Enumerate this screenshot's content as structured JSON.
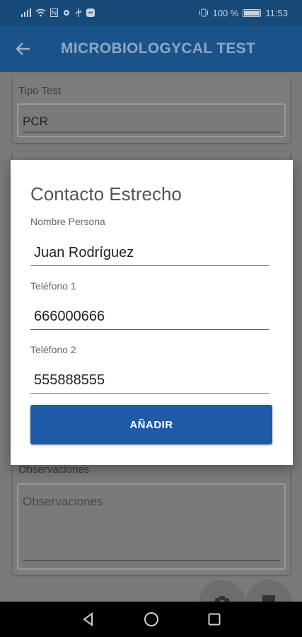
{
  "status_bar": {
    "battery_text": "100 %",
    "time": "11:53"
  },
  "app_bar": {
    "title": "MICROBIOLOGYCAL TEST"
  },
  "background": {
    "tipo_test_label": "Tipo Test",
    "tipo_test_value": "PCR",
    "observaciones_label": "Observaciones",
    "observaciones_placeholder": "Observaciones"
  },
  "dialog": {
    "title": "Contacto Estrecho",
    "nombre_label": "Nombre Persona",
    "nombre_value": "Juan Rodríguez",
    "telefono1_label": "Teléfono 1",
    "telefono1_value": "666000666",
    "telefono2_label": "Teléfono 2",
    "telefono2_value": "555888555",
    "add_button": "AÑADIR"
  },
  "colors": {
    "app_bar": "#1a538a",
    "button": "#1f5aa6"
  }
}
